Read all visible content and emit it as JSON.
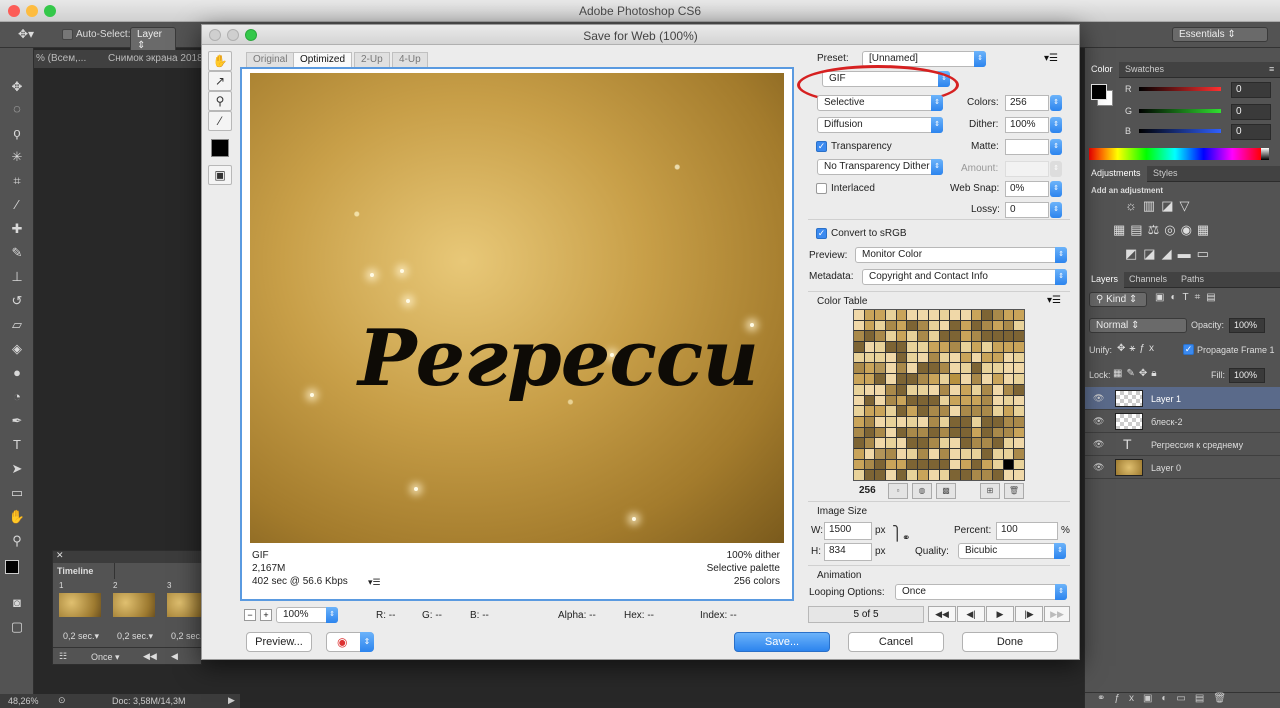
{
  "app": {
    "title": "Adobe Photoshop CS6"
  },
  "options_bar": {
    "auto_select_label": "Auto-Select:",
    "auto_select_value": "Layer",
    "workspace": "Essentials"
  },
  "doc_tabs": {
    "tab1": "% (Всем,...",
    "tab2": "Снимок экрана 2018"
  },
  "status_bar": {
    "zoom": "48,26%",
    "doc": "Doc: 3,58M/14,3M"
  },
  "timeline": {
    "title": "Timeline",
    "frames": [
      {
        "num": "1",
        "delay": "0,2 sec.▾"
      },
      {
        "num": "2",
        "delay": "0,2 sec.▾"
      },
      {
        "num": "3",
        "delay": "0,2 sec.▾"
      }
    ],
    "loop": "Once"
  },
  "right_panel": {
    "color_tabs": [
      "Color",
      "Swatches"
    ],
    "channels": [
      {
        "label": "R",
        "value": "0",
        "color": "#ff3030"
      },
      {
        "label": "G",
        "value": "0",
        "color": "#30e030"
      },
      {
        "label": "B",
        "value": "0",
        "color": "#3060ff"
      }
    ],
    "adj_tabs": [
      "Adjustments",
      "Styles"
    ],
    "add_adjustment": "Add an adjustment",
    "layers_tabs": [
      "Layers",
      "Channels",
      "Paths"
    ],
    "kind": "Kind",
    "blend": "Normal",
    "opacity_label": "Opacity:",
    "opacity": "100%",
    "unify": "Unify:",
    "propagate": "Propagate Frame 1",
    "lock": "Lock:",
    "fill_label": "Fill:",
    "fill": "100%",
    "layers": [
      {
        "name": "Layer 1",
        "selected": true
      },
      {
        "name": "блеск-2",
        "selected": false
      },
      {
        "name": "Регрессия к среднему",
        "selected": false
      },
      {
        "name": "Layer 0",
        "selected": false
      }
    ]
  },
  "dialog": {
    "title": "Save for Web (100%)",
    "view_tabs": [
      "Original",
      "Optimized",
      "2-Up",
      "4-Up"
    ],
    "image_text": "Регресси",
    "info_left": [
      "GIF",
      "2,167M",
      "402 sec @ 56.6 Kbps"
    ],
    "info_right": [
      "100% dither",
      "Selective palette",
      "256 colors"
    ],
    "zoom": "100%",
    "pixel_info": {
      "r": "R: --",
      "g": "G: --",
      "b": "B: --",
      "alpha": "Alpha: --",
      "hex": "Hex: --",
      "index": "Index: --"
    },
    "preset_label": "Preset:",
    "preset_value": "[Unnamed]",
    "format": "GIF",
    "reduction": "Selective",
    "colors_label": "Colors:",
    "colors": "256",
    "dither_algo": "Diffusion",
    "dither_label": "Dither:",
    "dither": "100%",
    "transparency": "Transparency",
    "matte_label": "Matte:",
    "trans_dither": "No Transparency Dither",
    "amount_label": "Amount:",
    "interlaced": "Interlaced",
    "websnap_label": "Web Snap:",
    "websnap": "0%",
    "lossy_label": "Lossy:",
    "lossy": "0",
    "convert_srgb": "Convert to sRGB",
    "preview_label": "Preview:",
    "preview_value": "Monitor Color",
    "metadata_label": "Metadata:",
    "metadata_value": "Copyright and Contact Info",
    "color_table_label": "Color Table",
    "color_count": "256",
    "image_size_label": "Image Size",
    "w_label": "W:",
    "w": "1500",
    "h_label": "H:",
    "h": "834",
    "px": "px",
    "percent_label": "Percent:",
    "percent": "100",
    "pct_sign": "%",
    "quality_label": "Quality:",
    "quality": "Bicubic",
    "animation_label": "Animation",
    "looping_label": "Looping Options:",
    "looping": "Once",
    "frame_counter": "5 of 5",
    "preview_btn": "Preview...",
    "save_btn": "Save...",
    "cancel_btn": "Cancel",
    "done_btn": "Done",
    "highlight_color": "#d62020"
  }
}
